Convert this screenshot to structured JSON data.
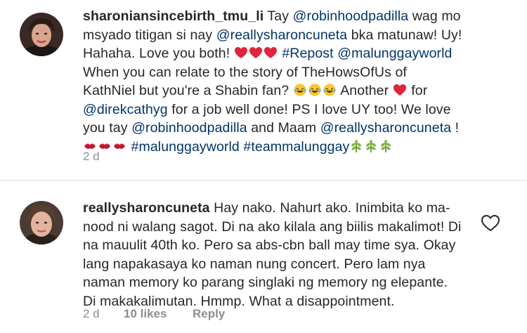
{
  "comments": [
    {
      "username": "sharoniansincebirth_tmu_li",
      "segments": [
        {
          "t": "Tay "
        },
        {
          "m": "@robinhoodpadilla"
        },
        {
          "t": " wag mo msyado titigan si nay "
        },
        {
          "m": "@reallysharoncuneta"
        },
        {
          "t": " bka matunaw! Uy! Hahaha. Love you both! "
        },
        {
          "e": "heart"
        },
        {
          "e": "heart"
        },
        {
          "e": "heart"
        },
        {
          "t": " "
        },
        {
          "m": "#Repost"
        },
        {
          "t": " "
        },
        {
          "m": "@malunggayworld"
        },
        {
          "t": " When you can relate to the story of TheHowsOfUs of KathNiel but you're a Shabin fan? "
        },
        {
          "e": "laugh"
        },
        {
          "e": "laugh"
        },
        {
          "e": "laugh"
        },
        {
          "t": " Another "
        },
        {
          "e": "heart"
        },
        {
          "t": " for "
        },
        {
          "m": "@direkcathyg"
        },
        {
          "t": " for a job well done! PS I love UY too! We love you tay "
        },
        {
          "m": "@robinhoodpadilla"
        },
        {
          "t": " and Maam "
        },
        {
          "m": "@reallysharoncuneta"
        },
        {
          "t": " ! "
        },
        {
          "e": "kiss"
        },
        {
          "e": "kiss"
        },
        {
          "e": "kiss"
        },
        {
          "t": " "
        },
        {
          "m": "#malunggayworld"
        },
        {
          "t": " "
        },
        {
          "m": "#teammalunggay"
        },
        {
          "e": "herb"
        },
        {
          "e": "herb"
        },
        {
          "e": "herb"
        }
      ],
      "time": "2 d"
    },
    {
      "username": "reallysharoncuneta",
      "segments": [
        {
          "t": "Hay nako. Nahurt ako. Inimbita ko ma-nood ni walang sagot. Di na ako kilala ang biilis makalimot! Di na mauulit 40th ko. Pero sa abs-cbn ball may time sya. Okay lang napakasaya ko naman nung concert. Pero lam nya naman memory ko parang singlaki ng memory ng elepante. Di makakalimutan. Hmmp. What a disappointment."
        }
      ],
      "time": "2 d",
      "likes": "10 likes",
      "reply": "Reply"
    }
  ],
  "colors": {
    "mention": "#003569",
    "meta": "#8e8e8e",
    "heart": "#ed1c3c",
    "divider": "#dbdbdb"
  },
  "icons": {
    "heart": "heart-emoji-icon",
    "laugh": "tears-of-joy-emoji-icon",
    "kiss": "kiss-mark-emoji-icon",
    "herb": "herb-emoji-icon",
    "like": "heart-outline-icon"
  }
}
